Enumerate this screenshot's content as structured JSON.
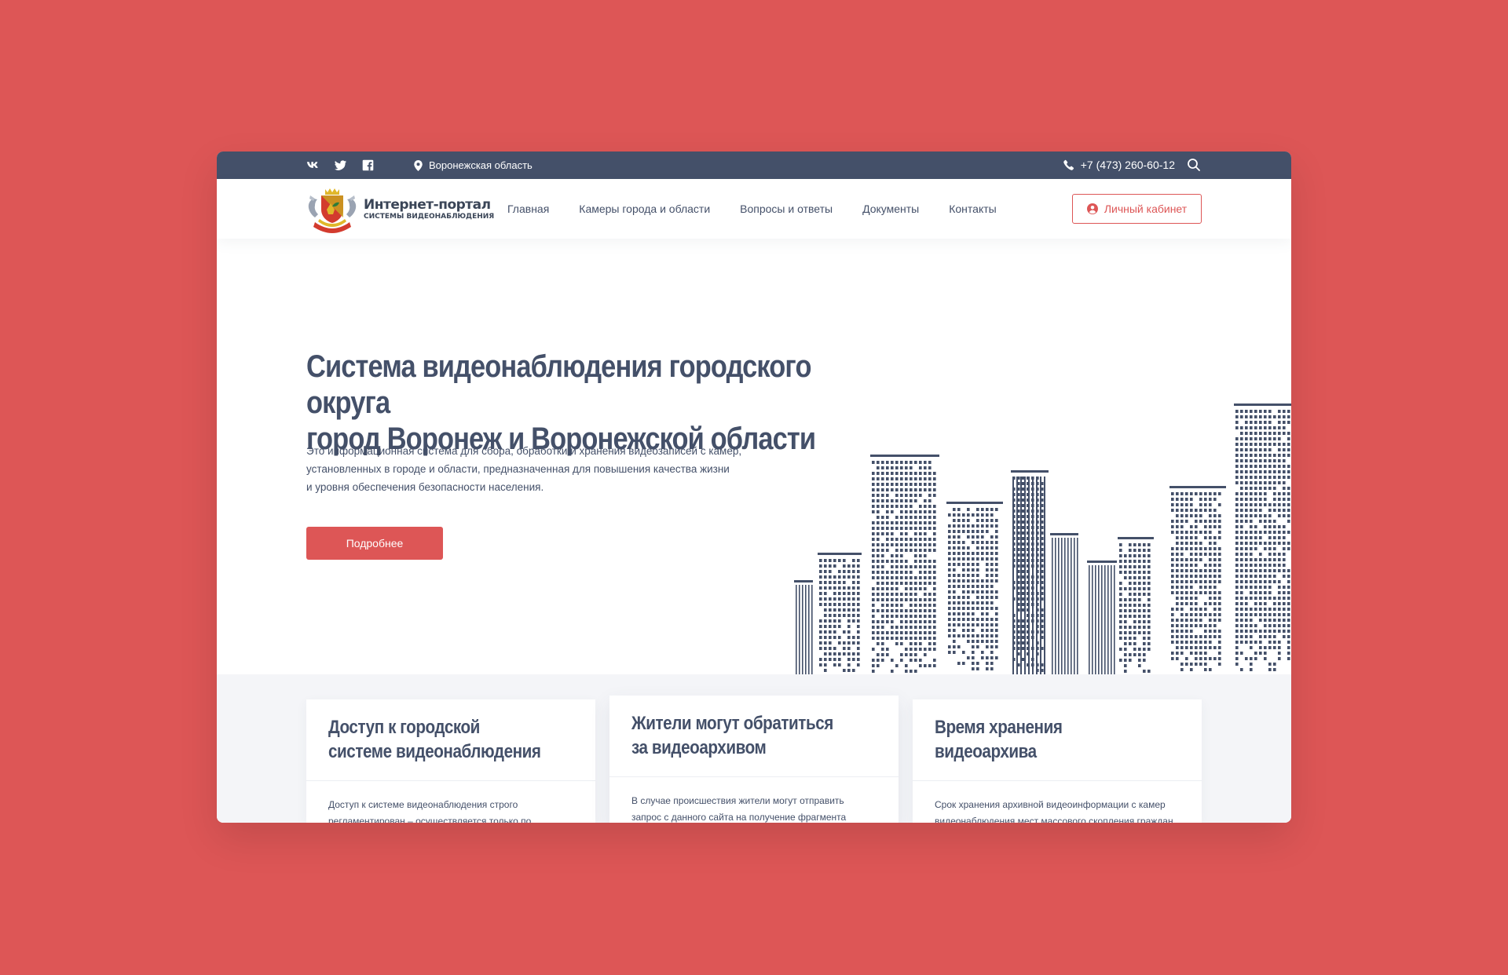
{
  "topbar": {
    "social": [
      "vk-icon",
      "twitter-icon",
      "facebook-icon"
    ],
    "region": "Воронежская область",
    "phone": "+7 (473) 260-60-12"
  },
  "logo": {
    "title": "Интернет-портал",
    "subtitle": "СИСТЕМЫ ВИДЕОНАБЛЮДЕНИЯ"
  },
  "nav": {
    "items": [
      "Главная",
      "Камеры города и области",
      "Вопросы и ответы",
      "Документы",
      "Контакты"
    ]
  },
  "cabinet_label": "Личный кабинет",
  "hero": {
    "title_line1": "Система видеонаблюдения городского округа",
    "title_line2": "город Воронеж и Воронежской области",
    "desc_line1": "Это информационная система для сбора, обработки и хранения видеозаписей с камер,",
    "desc_line2": "установленных в городе и области, предназначенная для повышения качества жизни",
    "desc_line3": "и уровня обеспечения безопасности населения.",
    "button": "Подробнее"
  },
  "cards": [
    {
      "title_line1": "Доступ к городской",
      "title_line2": "системе видеонаблюдения",
      "text_line1": "Доступ к системе видеонаблюдения строго",
      "text_line2": "регламентирован – осуществляется только по"
    },
    {
      "title_line1": "Жители могут обратиться",
      "title_line2": "за видеоархивом",
      "text_line1": "В случае происшествия жители могут отправить",
      "text_line2": "запрос с данного сайта на получение фрагмента"
    },
    {
      "title_line1": "Время хранения",
      "title_line2": "видеоархива",
      "text_line1": "Срок хранения архивной видеоинформации с камер",
      "text_line2": "видеонаблюдения мест массового скопления граждан"
    }
  ],
  "colors": {
    "background": "#dd5656",
    "topbar": "#445069",
    "accent": "#dd5656",
    "text": "#445069"
  }
}
